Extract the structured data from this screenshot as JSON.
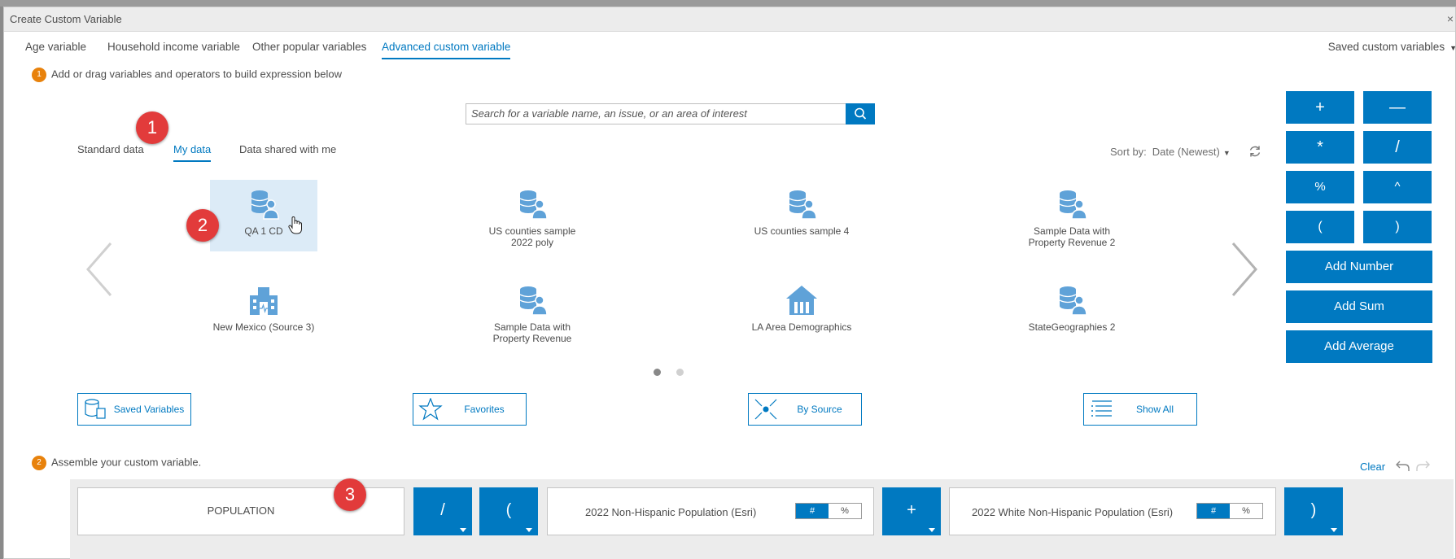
{
  "window": {
    "title": "Create Custom Variable",
    "close": "×"
  },
  "tabs": [
    "Age variable",
    "Household income variable",
    "Other popular variables",
    "Advanced custom variable"
  ],
  "saved_custom": "Saved custom variables",
  "step1": {
    "num": "1",
    "text": "Add or drag variables and operators to build expression below"
  },
  "search": {
    "placeholder": "Search for a variable name, an issue, or an area of interest"
  },
  "subtabs": [
    "Standard data",
    "My data",
    "Data shared with me"
  ],
  "sort": {
    "label": "Sort by:",
    "value": "Date (Newest)"
  },
  "tiles": [
    {
      "label": "QA 1 CD",
      "icon": "database-user-icon"
    },
    {
      "label": "US counties sample 2022 poly",
      "icon": "database-user-icon"
    },
    {
      "label": "US counties sample 4",
      "icon": "database-user-icon"
    },
    {
      "label": "Sample Data with Property Revenue 2",
      "icon": "database-user-icon"
    },
    {
      "label": "New Mexico (Source 3)",
      "icon": "building-icon"
    },
    {
      "label": "Sample Data with Property Revenue",
      "icon": "database-user-icon"
    },
    {
      "label": "LA Area Demographics",
      "icon": "house-icon"
    },
    {
      "label": "StateGeographies 2",
      "icon": "database-user-icon"
    }
  ],
  "browse_buttons": [
    "Saved Variables",
    "Favorites",
    "By Source",
    "Show All"
  ],
  "operators": [
    "+",
    "—",
    "*",
    "/",
    "%",
    "^",
    "(",
    ")"
  ],
  "wide_buttons": [
    "Add Number",
    "Add Sum",
    "Add Average"
  ],
  "step2": {
    "num": "2",
    "text": "Assemble your custom variable."
  },
  "clear": "Clear",
  "expression": {
    "name_box": "POPULATION",
    "op1": "/",
    "op2": "(",
    "var1": "2022 Non-Hispanic Population (Esri)",
    "op3": "+",
    "var2": "2022 White Non-Hispanic Population (Esri)",
    "op4": ")",
    "toggle_hash": "#",
    "toggle_pct": "%"
  },
  "badges": [
    "1",
    "2",
    "3"
  ],
  "colors": {
    "accent": "#0079c1",
    "step_badge": "#e8820c",
    "callout": "#e23b3b",
    "icon": "#5fa2d8"
  }
}
